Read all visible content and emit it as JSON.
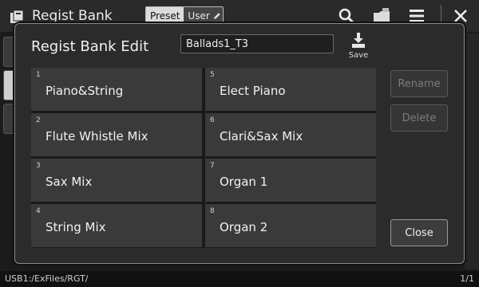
{
  "header": {
    "title": "Regist Bank",
    "tabs": [
      {
        "label": "Preset",
        "active": true
      },
      {
        "label": "User",
        "active": false
      }
    ],
    "icons": [
      "search-icon",
      "folder-icon",
      "menu-icon",
      "close-icon"
    ]
  },
  "dialog": {
    "title": "Regist Bank Edit",
    "bank_name": "Ballads1_T3",
    "save_label": "Save",
    "entries": [
      {
        "num": "1",
        "label": "Piano&String"
      },
      {
        "num": "2",
        "label": "Flute Whistle Mix"
      },
      {
        "num": "3",
        "label": "Sax Mix"
      },
      {
        "num": "4",
        "label": "String Mix"
      },
      {
        "num": "5",
        "label": "Elect Piano"
      },
      {
        "num": "6",
        "label": "Clari&Sax Mix"
      },
      {
        "num": "7",
        "label": "Organ 1"
      },
      {
        "num": "8",
        "label": "Organ 2"
      }
    ],
    "buttons": {
      "rename": "Rename",
      "delete": "Delete",
      "close": "Close"
    }
  },
  "status": {
    "path": "USB1:/ExFiles/RGT/",
    "page": "1/1"
  },
  "colors": {
    "background": "#1b1b1b",
    "dialog": "#2b2b2b",
    "cell": "#3a3a3a"
  }
}
